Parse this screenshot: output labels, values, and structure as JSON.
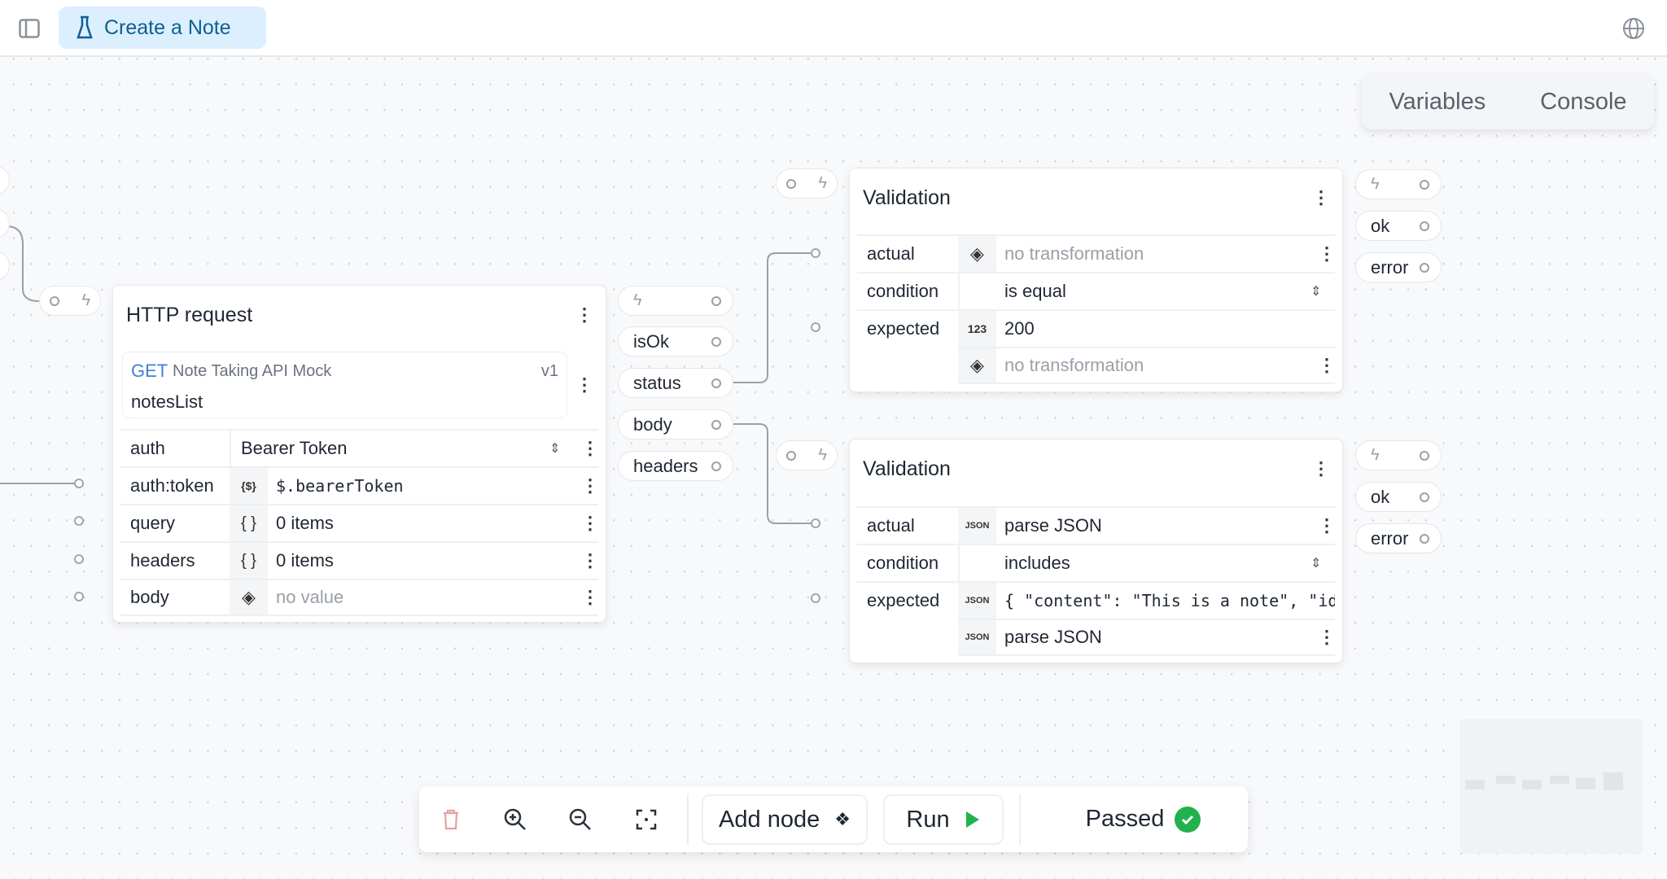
{
  "header": {
    "tab_title": "Create a Note",
    "icons": [
      "sidebar-toggle-icon",
      "flask-icon",
      "globe-icon"
    ]
  },
  "panel": {
    "variables": "Variables",
    "console": "Console"
  },
  "http_node": {
    "title": "HTTP request",
    "method": "GET",
    "api": "Note Taking API Mock",
    "version": "v1",
    "endpoint": "notesList",
    "rows": [
      {
        "label": "auth",
        "icon": "",
        "value": "Bearer Token"
      },
      {
        "label": "auth:token",
        "icon": "{$}",
        "value": "$.bearerToken"
      },
      {
        "label": "query",
        "icon": "{ }",
        "value": "0 items"
      },
      {
        "label": "headers",
        "icon": "{ }",
        "value": "0 items"
      },
      {
        "label": "body",
        "icon": "◈",
        "value": "no value"
      }
    ],
    "outputs": [
      "isOk",
      "status",
      "body",
      "headers"
    ]
  },
  "validation1": {
    "title": "Validation",
    "actual_label": "actual",
    "actual_value": "no transformation",
    "condition_label": "condition",
    "condition_value": "is equal",
    "expected_label": "expected",
    "expected_icon": "123",
    "expected_value": "200",
    "expected_transform": "no transformation",
    "outputs": [
      "ok",
      "error"
    ]
  },
  "validation2": {
    "title": "Validation",
    "actual_label": "actual",
    "actual_icon": "JSON",
    "actual_value": "parse JSON",
    "condition_label": "condition",
    "condition_value": "includes",
    "expected_label": "expected",
    "expected_icon": "JSON",
    "expected_value": "{ \"content\": \"This is a note\", \"id",
    "expected_transform": "parse JSON",
    "outputs": [
      "ok",
      "error"
    ]
  },
  "toolbar": {
    "add_node": "Add node",
    "run": "Run",
    "status": "Passed",
    "colors": {
      "run": "#22b14c",
      "passed": "#22b14c",
      "delete": "#e4a0a0"
    }
  }
}
